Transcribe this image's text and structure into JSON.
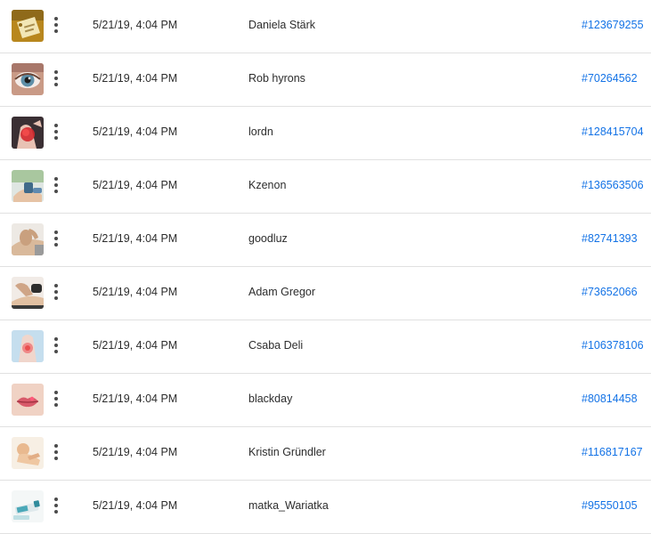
{
  "rows": [
    {
      "date": "5/21/19, 4:04 PM",
      "contributor": "Daniela Stärk",
      "asset_id": "#123679255",
      "thumbnail": "tag-label-thumbnail"
    },
    {
      "date": "5/21/19, 4:04 PM",
      "contributor": "Rob hyrons",
      "asset_id": "#70264562",
      "thumbnail": "eye-closeup-thumbnail"
    },
    {
      "date": "5/21/19, 4:04 PM",
      "contributor": "lordn",
      "asset_id": "#128415704",
      "thumbnail": "red-injury-thumbnail"
    },
    {
      "date": "5/21/19, 4:04 PM",
      "contributor": "Kzenon",
      "asset_id": "#136563506",
      "thumbnail": "physiotherapy-thumbnail"
    },
    {
      "date": "5/21/19, 4:04 PM",
      "contributor": "goodluz",
      "asset_id": "#82741393",
      "thumbnail": "knee-massage-thumbnail"
    },
    {
      "date": "5/21/19, 4:04 PM",
      "contributor": "Adam Gregor",
      "asset_id": "#73652066",
      "thumbnail": "back-massage-thumbnail"
    },
    {
      "date": "5/21/19, 4:04 PM",
      "contributor": "Csaba Deli",
      "asset_id": "#106378106",
      "thumbnail": "joint-pain-thumbnail"
    },
    {
      "date": "5/21/19, 4:04 PM",
      "contributor": "blackday",
      "asset_id": "#80814458",
      "thumbnail": "lips-closeup-thumbnail"
    },
    {
      "date": "5/21/19, 4:04 PM",
      "contributor": "Kristin Gründler",
      "asset_id": "#116817167",
      "thumbnail": "baby-thumbnail"
    },
    {
      "date": "5/21/19, 4:04 PM",
      "contributor": "matka_Wariatka",
      "asset_id": "#95550105",
      "thumbnail": "medicine-tube-thumbnail"
    }
  ],
  "colors": {
    "link": "#1473e6",
    "text": "#2c2c2c",
    "divider": "#e1e1e1"
  }
}
